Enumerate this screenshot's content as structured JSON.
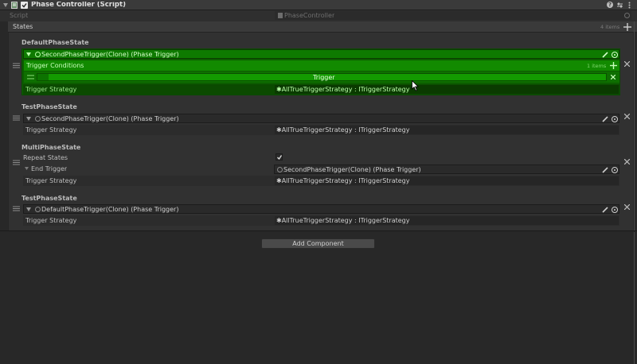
{
  "component": {
    "title": "Phase Controller (Script)",
    "script_label": "Script",
    "script_value": "PhaseController"
  },
  "states": {
    "label": "States",
    "count": "4 items"
  },
  "items": [
    {
      "title": "DefaultPhaseState",
      "trigger_ref": "SecondPhaseTrigger(Clone) (Phase Trigger)",
      "conditions_label": "Trigger Conditions",
      "conditions_count": "1 items",
      "condition_value": "Trigger",
      "strategy_label": "Trigger Strategy",
      "strategy_value": "AllTrueTriggerStrategy : ITriggerStrategy"
    },
    {
      "title": "TestPhaseState",
      "trigger_ref": "SecondPhaseTrigger(Clone) (Phase Trigger)",
      "strategy_label": "Trigger Strategy",
      "strategy_value": "AllTrueTriggerStrategy : ITriggerStrategy"
    },
    {
      "title": "MultiPhaseState",
      "repeat_label": "Repeat States",
      "end_trigger_label": "End Trigger",
      "end_trigger_value": "SecondPhaseTrigger(Clone) (Phase Trigger)",
      "strategy_label": "Trigger Strategy",
      "strategy_value": "AllTrueTriggerStrategy : ITriggerStrategy"
    },
    {
      "title": "TestPhaseState",
      "trigger_ref": "DefaultPhaseTrigger(Clone) (Phase Trigger)",
      "strategy_label": "Trigger Strategy",
      "strategy_value": "AllTrueTriggerStrategy : ITriggerStrategy"
    }
  ],
  "add_component_label": "Add Component",
  "colors": {
    "highlight_green": "#128a00",
    "panel_bg": "#282828",
    "header_bg": "#3a3a3a"
  },
  "icons": [
    "foldout-arrow-icon",
    "script-icon",
    "checkbox-icon",
    "help-icon",
    "preset-icon",
    "menu-icon",
    "drag-handle-icon",
    "edit-pencil-icon",
    "object-picker-icon",
    "close-x-icon",
    "plus-icon",
    "mouse-cursor-icon"
  ]
}
